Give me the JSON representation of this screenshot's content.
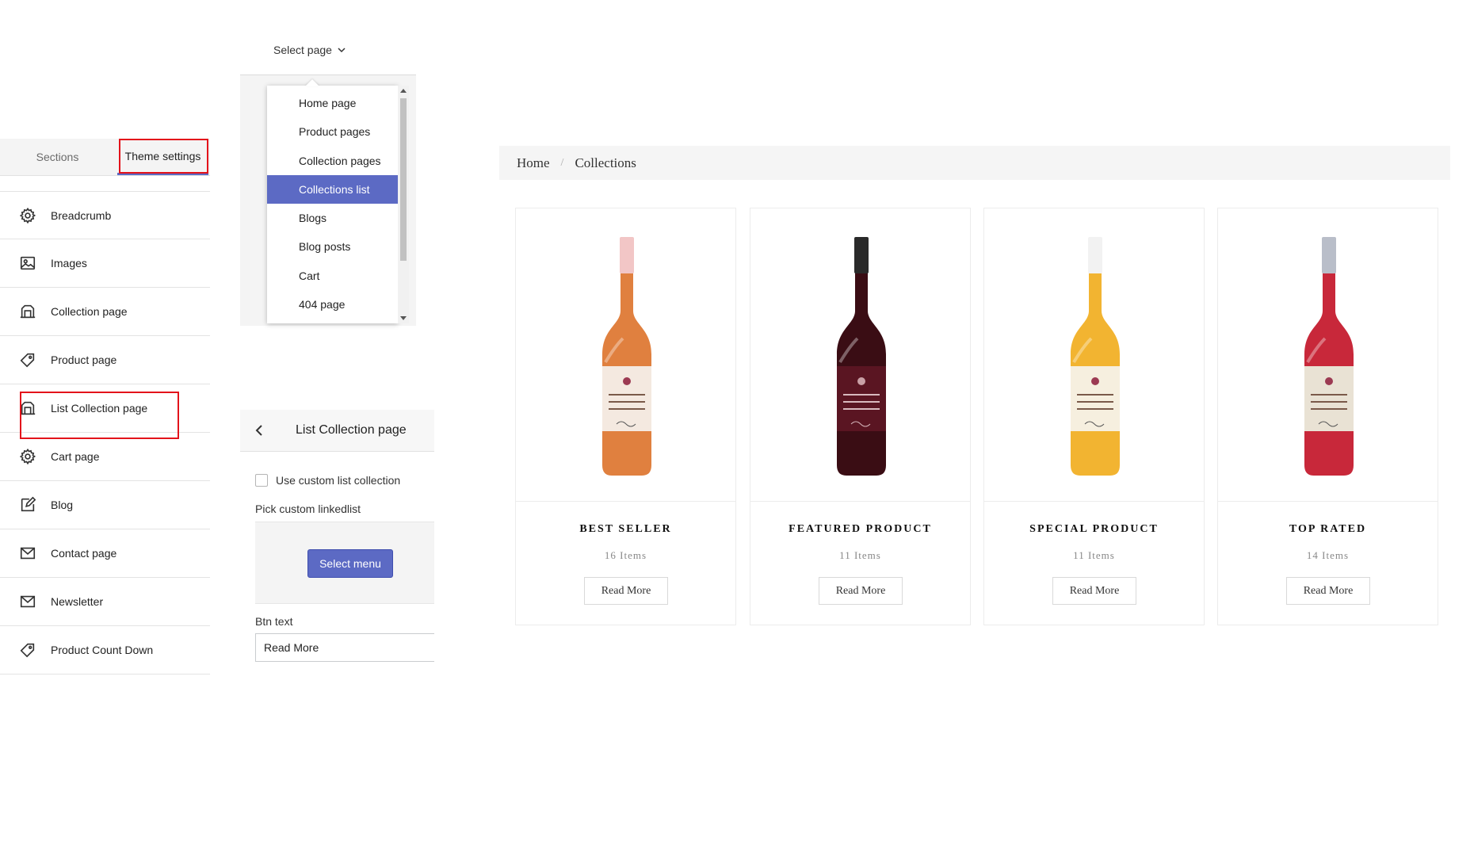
{
  "sidebar": {
    "tabs": {
      "sections": "Sections",
      "theme_settings": "Theme settings"
    },
    "items": [
      {
        "label": "Breadcrumb",
        "icon": "gear-icon"
      },
      {
        "label": "Images",
        "icon": "image-icon"
      },
      {
        "label": "Collection page",
        "icon": "collection-icon"
      },
      {
        "label": "Product page",
        "icon": "tag-icon"
      },
      {
        "label": "List Collection page",
        "icon": "collection-icon"
      },
      {
        "label": "Cart page",
        "icon": "gear-icon"
      },
      {
        "label": "Blog",
        "icon": "edit-icon"
      },
      {
        "label": "Contact page",
        "icon": "mail-icon"
      },
      {
        "label": "Newsletter",
        "icon": "mail-icon"
      },
      {
        "label": "Product Count Down",
        "icon": "tag-icon"
      }
    ]
  },
  "page_selector": {
    "trigger_label": "Select page",
    "options": [
      "Home page",
      "Product pages",
      "Collection pages",
      "Collections list",
      "Blogs",
      "Blog posts",
      "Cart",
      "404 page"
    ],
    "selected": "Collections list"
  },
  "editor": {
    "title": "List Collection page",
    "use_custom_label": "Use custom list collection",
    "pick_label": "Pick custom linkedlist",
    "select_menu_label": "Select menu",
    "btn_text_label": "Btn text",
    "btn_text_value": "Read More"
  },
  "preview": {
    "breadcrumb": {
      "home": "Home",
      "separator": "/",
      "current": "Collections"
    },
    "collections": [
      {
        "title": "BEST SELLER",
        "count": "16 Items",
        "button": "Read More",
        "wine_color": "#e0803f"
      },
      {
        "title": "FEATURED PRODUCT",
        "count": "11 Items",
        "button": "Read More",
        "wine_color": "#3a0d14"
      },
      {
        "title": "SPECIAL PRODUCT",
        "count": "11 Items",
        "button": "Read More",
        "wine_color": "#f2b431"
      },
      {
        "title": "TOP RATED",
        "count": "14 Items",
        "button": "Read More",
        "wine_color": "#c8283a"
      }
    ]
  },
  "colors": {
    "accent": "#5c6ac4",
    "highlight_box": "#e3131b"
  }
}
